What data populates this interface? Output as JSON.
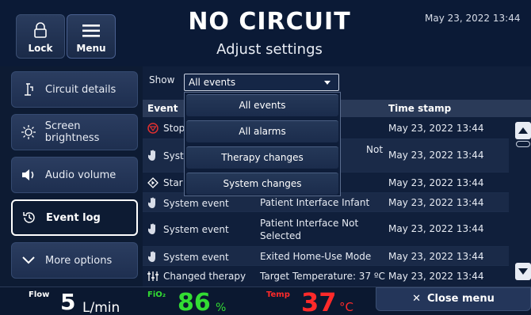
{
  "header": {
    "lock_label": "Lock",
    "menu_label": "Menu",
    "title": "NO CIRCUIT",
    "subtitle": "Adjust settings",
    "datetime": "May 23, 2022 13:44"
  },
  "sidebar": {
    "items": [
      {
        "label": "Circuit details",
        "icon": "circuit-icon"
      },
      {
        "label": "Screen brightness",
        "icon": "brightness-icon"
      },
      {
        "label": "Audio volume",
        "icon": "speaker-icon"
      },
      {
        "label": "Event log",
        "icon": "history-icon",
        "active": true
      },
      {
        "label": "More options",
        "icon": "chevron-down-icon"
      }
    ]
  },
  "event_log": {
    "show_label": "Show",
    "filter_value": "All events",
    "columns": [
      "Event",
      "Time stamp"
    ],
    "dropdown_options": [
      "All events",
      "All alarms",
      "Therapy changes",
      "System changes"
    ],
    "rows": [
      {
        "type": "Stop",
        "detail": "",
        "time": "May 23, 2022 13:44",
        "icon": "alarm-stop-icon"
      },
      {
        "type": "Syst",
        "detail": "Not",
        "time": "May 23, 2022 13:44",
        "icon": "hand-icon"
      },
      {
        "type": "Star",
        "detail": "",
        "time": "May 23, 2022 13:44",
        "icon": "start-diamond-icon"
      },
      {
        "type": "System event",
        "detail": "Patient Interface Infant",
        "time": "May 23, 2022 13:44",
        "icon": "hand-icon"
      },
      {
        "type": "System event",
        "detail": "Patient Interface Not Selected",
        "time": "May 23, 2022 13:44",
        "icon": "hand-icon"
      },
      {
        "type": "System event",
        "detail": "Exited Home-Use Mode",
        "time": "May 23, 2022 13:44",
        "icon": "hand-icon"
      },
      {
        "type": "Changed therapy",
        "detail": "Target Temperature: 37 ºC",
        "time": "May 23, 2022 13:44",
        "icon": "therapy-change-icon"
      }
    ]
  },
  "footer": {
    "flow_label": "Flow",
    "flow_value": "5",
    "flow_unit": "L/min",
    "fio2_label": "FiO₂",
    "fio2_value": "86",
    "fio2_unit": "%",
    "temp_label": "Temp",
    "temp_value": "37",
    "temp_unit": "°C",
    "close_menu_label": "Close menu"
  },
  "colors": {
    "fio2": "#33dd33",
    "temp": "#ff2a2a",
    "alarm": "#e03030"
  }
}
